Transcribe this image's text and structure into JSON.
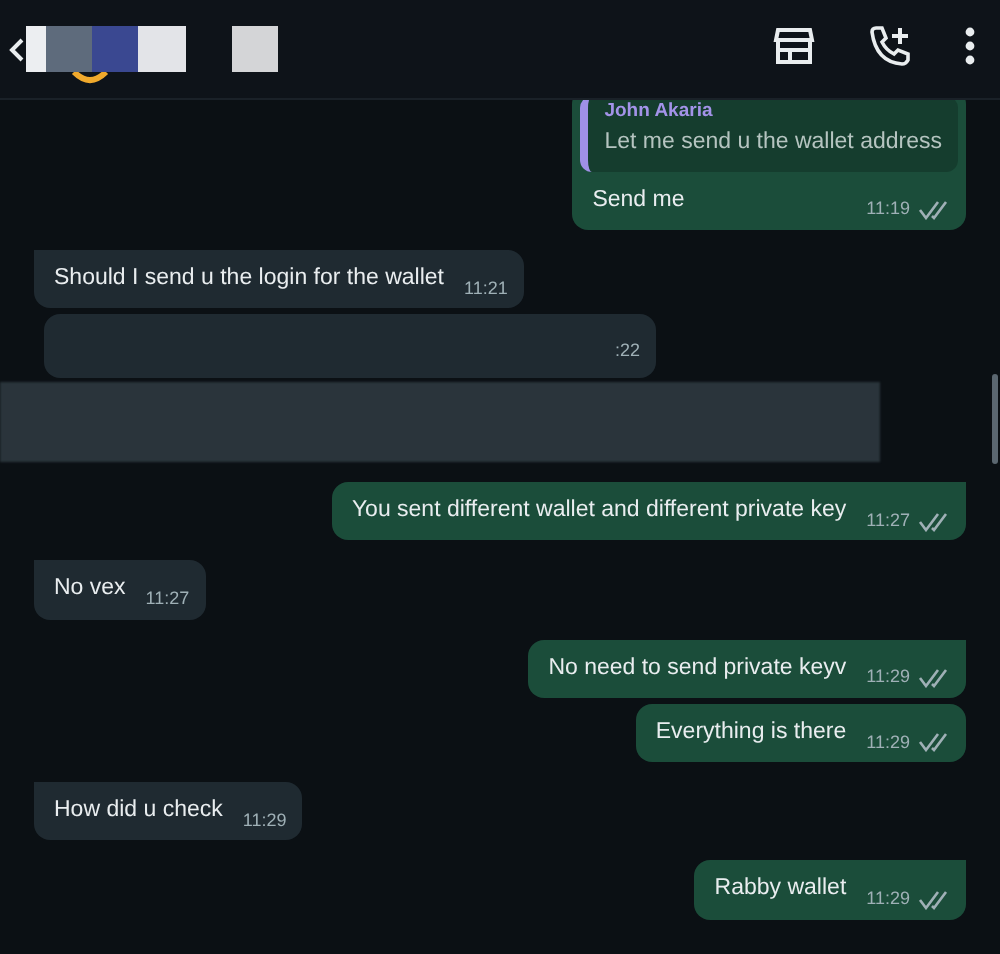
{
  "messages": [
    {
      "kind": "reply",
      "outgoing": true,
      "tail": false,
      "quote_author": "John Akaria",
      "quote_text": "Let me send u the wallet address",
      "text": "Send me",
      "time": "11:19",
      "read": false
    },
    {
      "kind": "text",
      "outgoing": false,
      "tail": true,
      "text": "Should I send u the login for the wallet",
      "time": "11:21"
    },
    {
      "kind": "redacted",
      "outgoing": false,
      "tail": false,
      "time": ":22"
    },
    {
      "kind": "text",
      "outgoing": true,
      "tail": true,
      "text": "You sent different wallet and different private key",
      "time": "11:27",
      "read": false
    },
    {
      "kind": "text",
      "outgoing": false,
      "tail": true,
      "text": "No vex",
      "time": "11:27"
    },
    {
      "kind": "text",
      "outgoing": true,
      "tail": true,
      "text": "No need to send private keyv",
      "time": "11:29",
      "read": false
    },
    {
      "kind": "text",
      "outgoing": true,
      "tail": false,
      "text": "Everything is there",
      "time": "11:29",
      "read": false
    },
    {
      "kind": "text",
      "outgoing": false,
      "tail": true,
      "text": "How did u check",
      "time": "11:29"
    },
    {
      "kind": "text",
      "outgoing": true,
      "tail": true,
      "text": "Rabby wallet",
      "time": "11:29",
      "read": false
    }
  ]
}
